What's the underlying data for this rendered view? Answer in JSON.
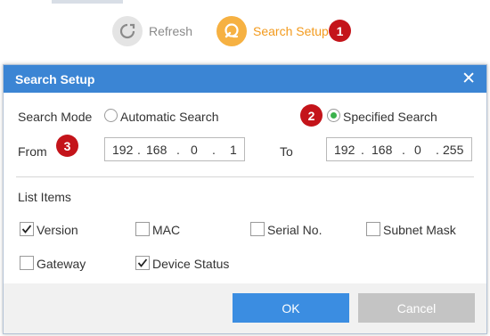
{
  "toolbar": {
    "refresh_label": "Refresh",
    "search_setup_label": "Search Setup",
    "badge_1": "1"
  },
  "dialog": {
    "title": "Search Setup",
    "close_glyph": "✕",
    "search_mode_label": "Search Mode",
    "automatic_search_label": "Automatic Search",
    "specified_search_label": "Specified Search",
    "badge_2": "2",
    "badge_3": "3",
    "from_label": "From",
    "to_label": "To",
    "from_ip": [
      "192",
      "168",
      "0",
      "1"
    ],
    "to_ip": [
      "192",
      "168",
      "0",
      "255"
    ],
    "list_items_label": "List Items",
    "items": {
      "version": {
        "label": "Version",
        "checked": true
      },
      "mac": {
        "label": "MAC",
        "checked": false
      },
      "serial_no": {
        "label": "Serial No.",
        "checked": false
      },
      "subnet_mask": {
        "label": "Subnet Mask",
        "checked": false
      },
      "gateway": {
        "label": "Gateway",
        "checked": false
      },
      "device_status": {
        "label": "Device Status",
        "checked": true
      }
    },
    "ok_label": "OK",
    "cancel_label": "Cancel"
  },
  "colors": {
    "title_bar": "#3b85d4",
    "accent_orange": "#f39a1c",
    "badge_red": "#c4141a",
    "ok_button": "#3b8de1",
    "cancel_button": "#c4c4c4",
    "radio_selected": "#3bb24c"
  }
}
